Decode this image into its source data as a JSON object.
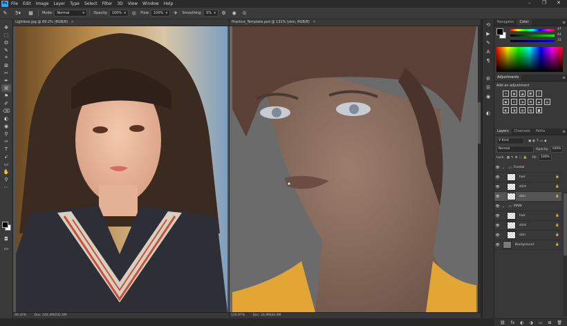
{
  "menu": {
    "logo": "Ps",
    "items": [
      "File",
      "Edit",
      "Image",
      "Layer",
      "Type",
      "Select",
      "Filter",
      "3D",
      "View",
      "Window",
      "Help"
    ],
    "window_controls": [
      "–",
      "❐",
      "✕"
    ]
  },
  "options": {
    "mode_label": "Mode:",
    "mode_value": "Normal",
    "opacity_label": "Opacity:",
    "opacity_value": "100%",
    "flow_label": "Flow:",
    "flow_value": "100%",
    "smoothing_label": "Smoothing:",
    "smoothing_value": "0%",
    "brush_size": "5"
  },
  "tools": [
    "✥",
    "⬚",
    "ʘ",
    "✎",
    "⌗",
    "⊠",
    "✂",
    "✒",
    "⌘",
    "⚑",
    "✐",
    "⌫",
    "◐",
    "◉",
    "⚲",
    "✑",
    "T",
    "➹",
    "▭",
    "✋",
    "⚲",
    "⋯"
  ],
  "docs": {
    "left": {
      "title": "Lightbox.jpg @ 69.2% (RGB/8)",
      "zoom": "69.32%",
      "doc": "Doc: 244.4M/231.0M"
    },
    "right": {
      "title": "Practice_Template.psd @ 131% (skin, RGB/8)",
      "zoom": "130.97%",
      "doc": "Doc: 24.9M/44.0M"
    }
  },
  "color_panel": {
    "tabs": [
      "Navigator",
      "Color"
    ],
    "active_tab": "Color",
    "values": [
      "47",
      "44",
      "33"
    ]
  },
  "adjustments": {
    "tab": "Adjustments",
    "add_label": "Add an adjustment",
    "row1": [
      "☀",
      "▦",
      "◪",
      "◩",
      "▽"
    ],
    "row2": [
      "▣",
      "⚖",
      "◑",
      "◓",
      "◒",
      "▤"
    ],
    "row3": [
      "◧",
      "◨",
      "▧",
      "▨",
      "◙"
    ]
  },
  "layers_panel": {
    "tabs": [
      "Layers",
      "Channels",
      "Paths"
    ],
    "active_tab": "Layers",
    "kind_label": "Kind",
    "blend_mode": "Normal",
    "opacity_label": "Opacity:",
    "opacity_value": "100%",
    "lock_label": "Lock:",
    "fill_label": "Fill:",
    "fill_value": "100%",
    "layers": [
      {
        "name": "Frontal",
        "type": "group"
      },
      {
        "name": "hair",
        "type": "layer"
      },
      {
        "name": "shirt",
        "type": "layer"
      },
      {
        "name": "skin",
        "type": "layer",
        "selected": true
      },
      {
        "name": "MAIN",
        "type": "group"
      },
      {
        "name": "hair",
        "type": "layer"
      },
      {
        "name": "shirt",
        "type": "layer"
      },
      {
        "name": "skin",
        "type": "layer"
      },
      {
        "name": "Background",
        "type": "background"
      }
    ],
    "bottom_icons": [
      "⛓",
      "fx",
      "◐",
      "◑",
      "▭",
      "⊞",
      "🗑"
    ]
  },
  "colors": {
    "accent": "#31a8ff",
    "app_bg": "#282828",
    "panel_bg": "#383838",
    "canvas_gray": "#6b6b6b"
  }
}
